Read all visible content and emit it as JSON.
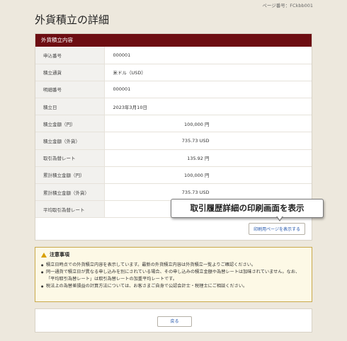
{
  "page_id": "ページ番号：FCkbb001",
  "page_title": "外貨積立の詳細",
  "panel": {
    "header": "外貨積立内容",
    "rows": [
      {
        "label": "申込番号",
        "value": "000001"
      },
      {
        "label": "積立通貨",
        "value": "米ドル（USD）"
      },
      {
        "label": "明細番号",
        "value": "000001"
      },
      {
        "label": "積立日",
        "value": "2023年3月10日"
      },
      {
        "label": "積立金額（円）",
        "value": "100,000 円"
      },
      {
        "label": "積立金額（外貨）",
        "value": "735.73 USD"
      },
      {
        "label": "取引為替レート",
        "value": "135.92 円"
      },
      {
        "label": "累計積立金額（円）",
        "value": "100,000 円"
      },
      {
        "label": "累計積立金額（外貨）",
        "value": "735.73 USD"
      },
      {
        "label": "平均取引為替レート",
        "value": ""
      }
    ],
    "print_link": "印刷用ページを表示する"
  },
  "tooltip": "取引履歴詳細の印刷画面を表示",
  "notice": {
    "title": "注意事項",
    "items": [
      "積立日時点での外貨積立内容を表示しています。最新の外貨積立内容は外貨積立一覧よりご確認ください。",
      "同一通貨で積立日が異なる申し込みを別にされている場合、その申し込みの積立金額や為替レートは加味されていません。なお、「平均取引為替レート」は取引為替レートの加重平均レートです。",
      "税法上の為替差損益の計算方法については、お客さまご自身で公認会計士・税理士にご相談ください。"
    ]
  },
  "back_button": "戻る",
  "colors": {
    "header_bg": "#6d0d12",
    "page_bg": "#ede8dd",
    "notice_bg": "#fdf9e6",
    "notice_border": "#c9a94a",
    "link": "#2255aa"
  }
}
